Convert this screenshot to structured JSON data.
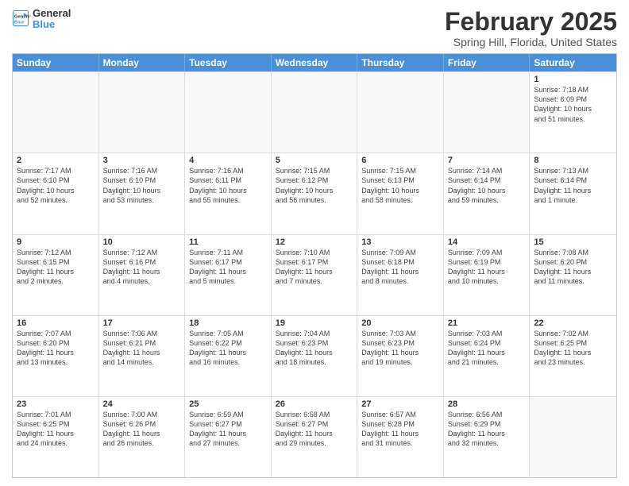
{
  "header": {
    "logo_line1": "General",
    "logo_line2": "Blue",
    "month": "February 2025",
    "location": "Spring Hill, Florida, United States"
  },
  "weekdays": [
    "Sunday",
    "Monday",
    "Tuesday",
    "Wednesday",
    "Thursday",
    "Friday",
    "Saturday"
  ],
  "rows": [
    [
      {
        "day": "",
        "info": ""
      },
      {
        "day": "",
        "info": ""
      },
      {
        "day": "",
        "info": ""
      },
      {
        "day": "",
        "info": ""
      },
      {
        "day": "",
        "info": ""
      },
      {
        "day": "",
        "info": ""
      },
      {
        "day": "1",
        "info": "Sunrise: 7:18 AM\nSunset: 6:09 PM\nDaylight: 10 hours\nand 51 minutes."
      }
    ],
    [
      {
        "day": "2",
        "info": "Sunrise: 7:17 AM\nSunset: 6:10 PM\nDaylight: 10 hours\nand 52 minutes."
      },
      {
        "day": "3",
        "info": "Sunrise: 7:16 AM\nSunset: 6:10 PM\nDaylight: 10 hours\nand 53 minutes."
      },
      {
        "day": "4",
        "info": "Sunrise: 7:16 AM\nSunset: 6:11 PM\nDaylight: 10 hours\nand 55 minutes."
      },
      {
        "day": "5",
        "info": "Sunrise: 7:15 AM\nSunset: 6:12 PM\nDaylight: 10 hours\nand 56 minutes."
      },
      {
        "day": "6",
        "info": "Sunrise: 7:15 AM\nSunset: 6:13 PM\nDaylight: 10 hours\nand 58 minutes."
      },
      {
        "day": "7",
        "info": "Sunrise: 7:14 AM\nSunset: 6:14 PM\nDaylight: 10 hours\nand 59 minutes."
      },
      {
        "day": "8",
        "info": "Sunrise: 7:13 AM\nSunset: 6:14 PM\nDaylight: 11 hours\nand 1 minute."
      }
    ],
    [
      {
        "day": "9",
        "info": "Sunrise: 7:12 AM\nSunset: 6:15 PM\nDaylight: 11 hours\nand 2 minutes."
      },
      {
        "day": "10",
        "info": "Sunrise: 7:12 AM\nSunset: 6:16 PM\nDaylight: 11 hours\nand 4 minutes."
      },
      {
        "day": "11",
        "info": "Sunrise: 7:11 AM\nSunset: 6:17 PM\nDaylight: 11 hours\nand 5 minutes."
      },
      {
        "day": "12",
        "info": "Sunrise: 7:10 AM\nSunset: 6:17 PM\nDaylight: 11 hours\nand 7 minutes."
      },
      {
        "day": "13",
        "info": "Sunrise: 7:09 AM\nSunset: 6:18 PM\nDaylight: 11 hours\nand 8 minutes."
      },
      {
        "day": "14",
        "info": "Sunrise: 7:09 AM\nSunset: 6:19 PM\nDaylight: 11 hours\nand 10 minutes."
      },
      {
        "day": "15",
        "info": "Sunrise: 7:08 AM\nSunset: 6:20 PM\nDaylight: 11 hours\nand 11 minutes."
      }
    ],
    [
      {
        "day": "16",
        "info": "Sunrise: 7:07 AM\nSunset: 6:20 PM\nDaylight: 11 hours\nand 13 minutes."
      },
      {
        "day": "17",
        "info": "Sunrise: 7:06 AM\nSunset: 6:21 PM\nDaylight: 11 hours\nand 14 minutes."
      },
      {
        "day": "18",
        "info": "Sunrise: 7:05 AM\nSunset: 6:22 PM\nDaylight: 11 hours\nand 16 minutes."
      },
      {
        "day": "19",
        "info": "Sunrise: 7:04 AM\nSunset: 6:23 PM\nDaylight: 11 hours\nand 18 minutes."
      },
      {
        "day": "20",
        "info": "Sunrise: 7:03 AM\nSunset: 6:23 PM\nDaylight: 11 hours\nand 19 minutes."
      },
      {
        "day": "21",
        "info": "Sunrise: 7:03 AM\nSunset: 6:24 PM\nDaylight: 11 hours\nand 21 minutes."
      },
      {
        "day": "22",
        "info": "Sunrise: 7:02 AM\nSunset: 6:25 PM\nDaylight: 11 hours\nand 23 minutes."
      }
    ],
    [
      {
        "day": "23",
        "info": "Sunrise: 7:01 AM\nSunset: 6:25 PM\nDaylight: 11 hours\nand 24 minutes."
      },
      {
        "day": "24",
        "info": "Sunrise: 7:00 AM\nSunset: 6:26 PM\nDaylight: 11 hours\nand 26 minutes."
      },
      {
        "day": "25",
        "info": "Sunrise: 6:59 AM\nSunset: 6:27 PM\nDaylight: 11 hours\nand 27 minutes."
      },
      {
        "day": "26",
        "info": "Sunrise: 6:58 AM\nSunset: 6:27 PM\nDaylight: 11 hours\nand 29 minutes."
      },
      {
        "day": "27",
        "info": "Sunrise: 6:57 AM\nSunset: 6:28 PM\nDaylight: 11 hours\nand 31 minutes."
      },
      {
        "day": "28",
        "info": "Sunrise: 6:56 AM\nSunset: 6:29 PM\nDaylight: 11 hours\nand 32 minutes."
      },
      {
        "day": "",
        "info": ""
      }
    ]
  ]
}
